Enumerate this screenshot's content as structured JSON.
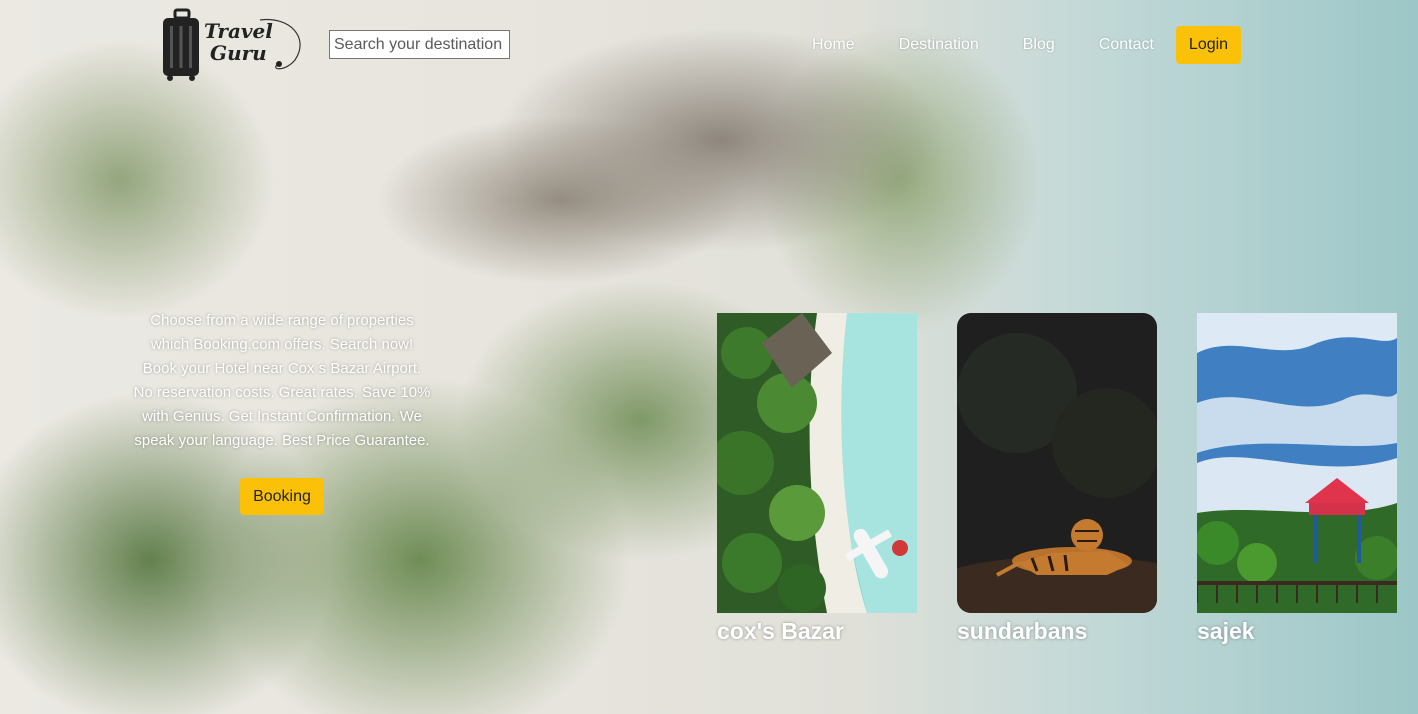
{
  "brand": {
    "line1": "Travel",
    "line2": "Guru"
  },
  "search": {
    "placeholder": "Search your destination",
    "value": ""
  },
  "nav": {
    "items": [
      {
        "label": "Home"
      },
      {
        "label": "Destination"
      },
      {
        "label": "Blog"
      },
      {
        "label": "Contact"
      }
    ],
    "login_label": "Login"
  },
  "hero": {
    "description": "Choose from a wide range of properties which Booking.com offers. Search now! Book your Hotel near Cox s Bazar Airport. No reservation costs. Great rates. Save 10% with Genius. Get Instant Confirmation. We speak your language. Best Price Guarantee.",
    "booking_label": "Booking"
  },
  "destinations": [
    {
      "name": "cox's Bazar"
    },
    {
      "name": "sundarbans"
    },
    {
      "name": "sajek"
    }
  ],
  "colors": {
    "accent": "#fbc108",
    "nav_text": "#ffffff"
  }
}
